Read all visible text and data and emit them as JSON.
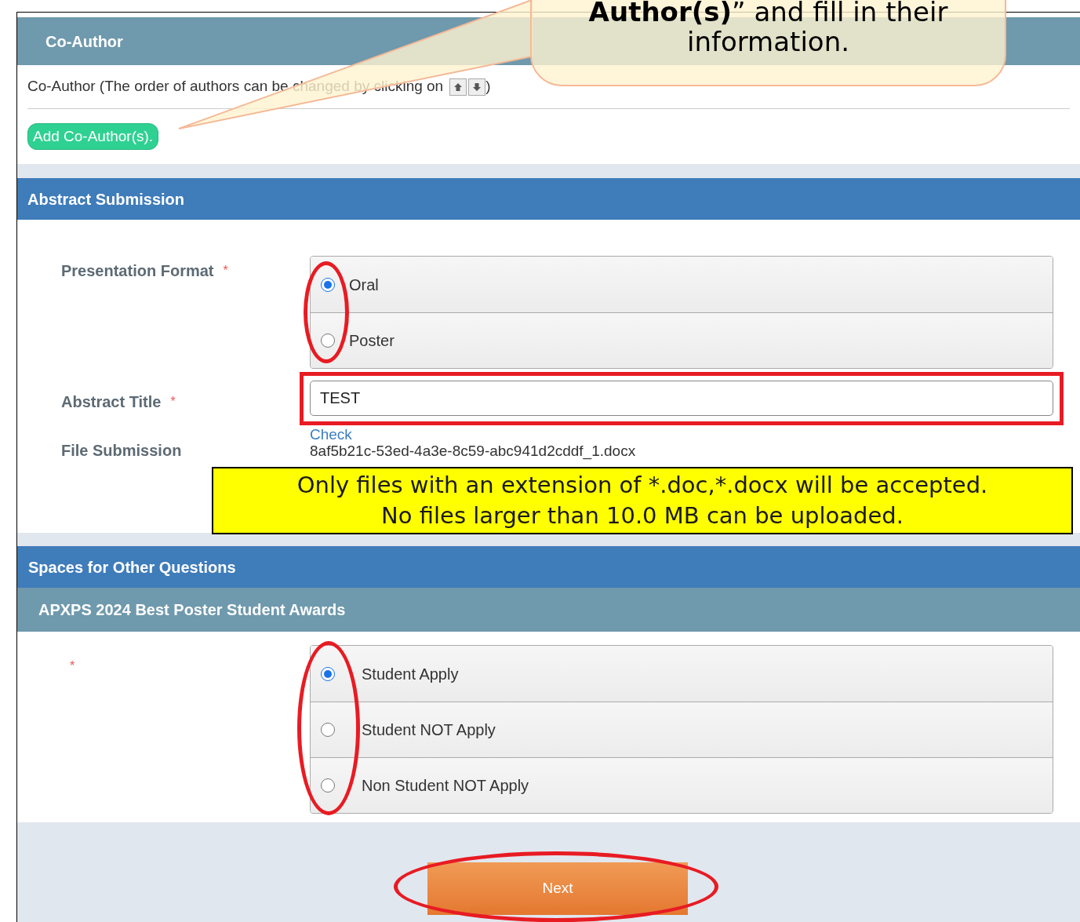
{
  "callout": {
    "lines": [
      "**Author(s)**” and fill in their",
      "information."
    ]
  },
  "co_author": {
    "title": "Co-Author",
    "note": "Co-Author (The order of authors can be changed by clicking on",
    "note_end": ")",
    "add_button": "Add Co-Author(s)."
  },
  "abstract_submission": {
    "title": "Abstract Submission",
    "presentation_format": {
      "label": "Presentation Format",
      "required_mark": "*",
      "options": [
        {
          "label": "Oral",
          "selected": true
        },
        {
          "label": "Poster",
          "selected": false
        }
      ]
    },
    "abstract_title": {
      "label": "Abstract Title",
      "required_mark": "*",
      "value": "TEST"
    },
    "file_submission": {
      "label": "File Submission",
      "link": "Check",
      "file_name": "8af5b21c-53ed-4a3e-8c59-abc941d2cddf_1.docx"
    },
    "notice": [
      "Only files with an extension of *.doc,*.docx will be accepted.",
      "No files larger than 10.0 MB can be uploaded."
    ]
  },
  "other_questions": {
    "title": "Spaces for Other Questions",
    "subtitle": "APXPS 2024 Best Poster Student Awards",
    "required_mark": "*",
    "options": [
      {
        "label": "Student Apply",
        "selected": true
      },
      {
        "label": "Student NOT Apply",
        "selected": false
      },
      {
        "label": "Non Student NOT Apply",
        "selected": false
      }
    ]
  },
  "next_button": "Next"
}
